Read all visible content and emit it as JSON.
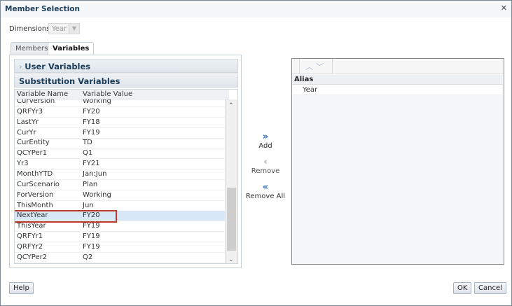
{
  "dialog": {
    "title": "Member Selection"
  },
  "dimensions": {
    "label": "Dimensions",
    "value": "Year"
  },
  "tabs": [
    {
      "label": "Members"
    },
    {
      "label": "Variables"
    }
  ],
  "left": {
    "user_variables": "User Variables",
    "substitution_variables": "Substitution Variables",
    "columns": [
      "Variable Name",
      "Variable Value"
    ],
    "rows": [
      [
        "CurVersion",
        "Working"
      ],
      [
        "QRFYr3",
        "FY20"
      ],
      [
        "LastYr",
        "FY18"
      ],
      [
        "CurYr",
        "FY19"
      ],
      [
        "CurEntity",
        "TD"
      ],
      [
        "QCYPer1",
        "Q1"
      ],
      [
        "Yr3",
        "FY21"
      ],
      [
        "MonthYTD",
        "Jan:Jun"
      ],
      [
        "CurScenario",
        "Plan"
      ],
      [
        "ForVersion",
        "Working"
      ],
      [
        "ThisMonth",
        "Jun"
      ],
      [
        "NextYear",
        "FY20"
      ],
      [
        "ThisYear",
        "FY19"
      ],
      [
        "QRFYr1",
        "FY19"
      ],
      [
        "QRFYr2",
        "FY19"
      ],
      [
        "QCYPer2",
        "Q2"
      ]
    ],
    "selected_index": 11
  },
  "actions": {
    "add": "Add",
    "remove": "Remove",
    "remove_all": "Remove All"
  },
  "right": {
    "column": "Alias",
    "items": [
      "Year"
    ]
  },
  "footer": {
    "help": "Help",
    "ok": "OK",
    "cancel": "Cancel"
  }
}
